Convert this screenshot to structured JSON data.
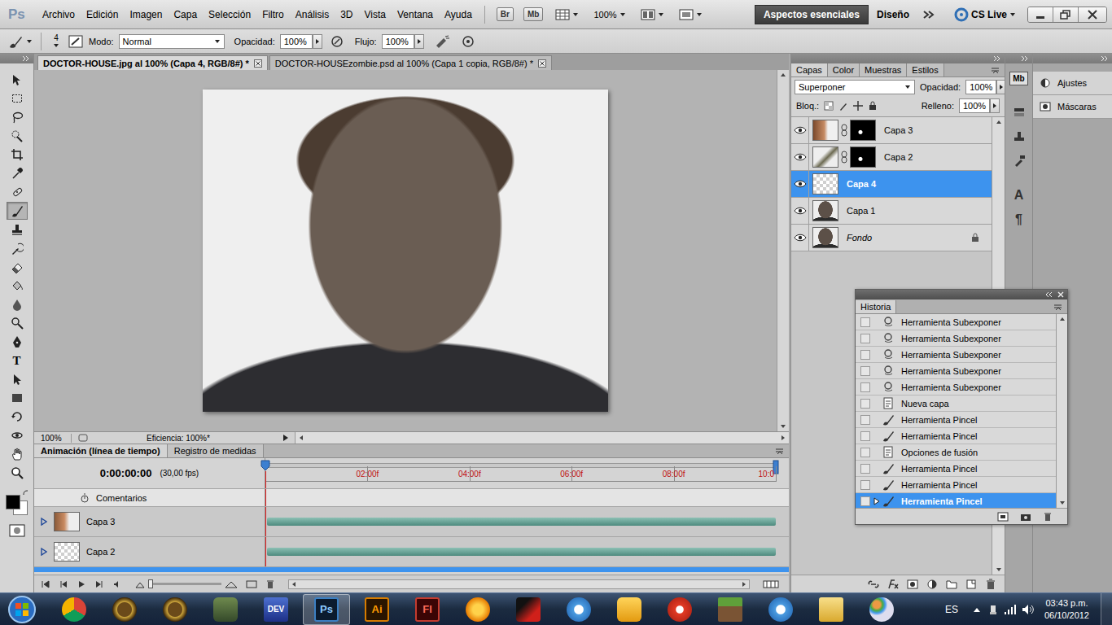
{
  "app": {
    "logo": "Ps"
  },
  "menu": [
    "Archivo",
    "Edición",
    "Imagen",
    "Capa",
    "Selección",
    "Filtro",
    "Análisis",
    "3D",
    "Vista",
    "Ventana",
    "Ayuda"
  ],
  "launchers": [
    "Br",
    "Mb"
  ],
  "zoom": "100%",
  "workspaces": [
    {
      "label": "Aspectos esenciales",
      "selected": true
    },
    {
      "label": "Diseño",
      "selected": false
    }
  ],
  "cs_live": "CS Live",
  "options": {
    "size": "4",
    "mode_label": "Modo:",
    "mode": "Normal",
    "opacity_label": "Opacidad:",
    "opacity": "100%",
    "flow_label": "Flujo:",
    "flow": "100%"
  },
  "tools": [
    {
      "kind": "move",
      "selected": false
    },
    {
      "kind": "marquee",
      "selected": false
    },
    {
      "kind": "lasso",
      "selected": false
    },
    {
      "kind": "quick-select",
      "selected": false
    },
    {
      "kind": "crop",
      "selected": false
    },
    {
      "kind": "eyedropper",
      "selected": false
    },
    {
      "kind": "healing",
      "selected": false
    },
    {
      "kind": "brush",
      "selected": true
    },
    {
      "kind": "stamp",
      "selected": false
    },
    {
      "kind": "history-brush",
      "selected": false
    },
    {
      "kind": "eraser",
      "selected": false
    },
    {
      "kind": "bucket",
      "selected": false
    },
    {
      "kind": "blur",
      "selected": false
    },
    {
      "kind": "dodge",
      "selected": false
    },
    {
      "kind": "pen",
      "selected": false
    },
    {
      "kind": "type",
      "label": "T",
      "selected": false
    },
    {
      "kind": "path-select",
      "selected": false
    },
    {
      "kind": "shape",
      "selected": false
    },
    {
      "kind": "rotate-3d",
      "selected": false
    },
    {
      "kind": "orbit-3d",
      "selected": false
    },
    {
      "kind": "hand",
      "selected": false
    },
    {
      "kind": "zoom",
      "selected": false
    }
  ],
  "colors": {
    "foreground": "#000000",
    "background": "#ffffff"
  },
  "documents": [
    {
      "title": "DOCTOR-HOUSE.jpg al 100% (Capa 4, RGB/8#) *",
      "selected": true
    },
    {
      "title": "DOCTOR-HOUSEzombie.psd al 100% (Capa 1 copia, RGB/8#) *",
      "selected": false
    }
  ],
  "status_bar": {
    "zoom": "100%",
    "info": "Eficiencia: 100%*"
  },
  "timeline": {
    "tabs": [
      {
        "label": "Animación (línea de tiempo)",
        "selected": true
      },
      {
        "label": "Registro de medidas",
        "selected": false
      }
    ],
    "time": "0:00:00:00",
    "fps": "(30,00 fps)",
    "ticks": [
      "02:00f",
      "04:00f",
      "06:00f",
      "08:00f",
      "10:0"
    ],
    "playhead": 0,
    "comments": "Comentarios",
    "layers": [
      {
        "name": "Capa 3",
        "level": 1
      },
      {
        "name": "Capa 2",
        "level": 1
      }
    ]
  },
  "layers_panel": {
    "tabs": [
      {
        "label": "Capas",
        "selected": true
      },
      {
        "label": "Color",
        "selected": false
      },
      {
        "label": "Muestras",
        "selected": false
      },
      {
        "label": "Estilos",
        "selected": false
      }
    ],
    "blend_mode": "Superponer",
    "opacity_label": "Opacidad:",
    "opacity": "100%",
    "lock_label": "Bloq.:",
    "fill_label": "Relleno:",
    "fill": "100%",
    "layers": [
      {
        "name": "Capa 3",
        "kind": "masked",
        "visible": true,
        "selected": false
      },
      {
        "name": "Capa 2",
        "kind": "masked",
        "visible": true,
        "selected": false
      },
      {
        "name": "Capa 4",
        "kind": "empty",
        "visible": true,
        "selected": true
      },
      {
        "name": "Capa 1",
        "kind": "photo",
        "visible": true,
        "selected": false
      },
      {
        "name": "Fondo",
        "kind": "background",
        "visible": true,
        "selected": false
      }
    ]
  },
  "dock_icons": [
    {
      "kind": "mini-bridge",
      "label": "Mb"
    },
    {
      "kind": "layer-comps"
    },
    {
      "kind": "clone-source"
    },
    {
      "kind": "tool-presets"
    },
    {
      "kind": "character",
      "label": "A"
    },
    {
      "kind": "paragraph",
      "label": "¶"
    }
  ],
  "dock_panels": [
    {
      "label": "Ajustes"
    },
    {
      "label": "Máscaras"
    }
  ],
  "history": {
    "title": "Historia",
    "items": [
      {
        "label": "Herramienta Subexponer",
        "kind": "burn",
        "checked": false,
        "selected": false
      },
      {
        "label": "Herramienta Subexponer",
        "kind": "burn",
        "checked": false,
        "selected": false
      },
      {
        "label": "Herramienta Subexponer",
        "kind": "burn",
        "checked": false,
        "selected": false
      },
      {
        "label": "Herramienta Subexponer",
        "kind": "burn",
        "checked": false,
        "selected": false
      },
      {
        "label": "Herramienta Subexponer",
        "kind": "burn",
        "checked": false,
        "selected": false
      },
      {
        "label": "Nueva capa",
        "kind": "document",
        "checked": false,
        "selected": false
      },
      {
        "label": "Herramienta Pincel",
        "kind": "brush",
        "checked": false,
        "selected": false
      },
      {
        "label": "Herramienta Pincel",
        "kind": "brush",
        "checked": false,
        "selected": false
      },
      {
        "label": "Opciones de fusión",
        "kind": "document",
        "checked": false,
        "selected": false
      },
      {
        "label": "Herramienta Pincel",
        "kind": "brush",
        "checked": false,
        "selected": false
      },
      {
        "label": "Herramienta Pincel",
        "kind": "brush",
        "checked": false,
        "selected": false
      },
      {
        "label": "Herramienta Pincel",
        "kind": "brush",
        "checked": false,
        "selected": true
      }
    ]
  },
  "taskbar": {
    "apps": [
      {
        "kind": "chrome",
        "selected": false
      },
      {
        "kind": "wow",
        "selected": false
      },
      {
        "kind": "wow",
        "selected": false
      },
      {
        "kind": "halo",
        "selected": false
      },
      {
        "kind": "devcpp",
        "label": "DEV",
        "selected": false
      },
      {
        "kind": "photoshop",
        "label": "Ps",
        "selected": true
      },
      {
        "kind": "illustrator",
        "label": "Ai",
        "selected": false
      },
      {
        "kind": "flash",
        "label": "Fl",
        "selected": false
      },
      {
        "kind": "flstudio",
        "selected": false
      },
      {
        "kind": "game",
        "selected": false
      },
      {
        "kind": "itunes",
        "selected": false
      },
      {
        "kind": "puzzle",
        "selected": false
      },
      {
        "kind": "ccleaner",
        "selected": false
      },
      {
        "kind": "minecraft",
        "selected": false
      },
      {
        "kind": "itunes",
        "selected": false
      },
      {
        "kind": "folder",
        "selected": false
      },
      {
        "kind": "paint",
        "selected": false
      }
    ],
    "language": "ES",
    "time": "03:43 p.m.",
    "date": "06/10/2012"
  }
}
